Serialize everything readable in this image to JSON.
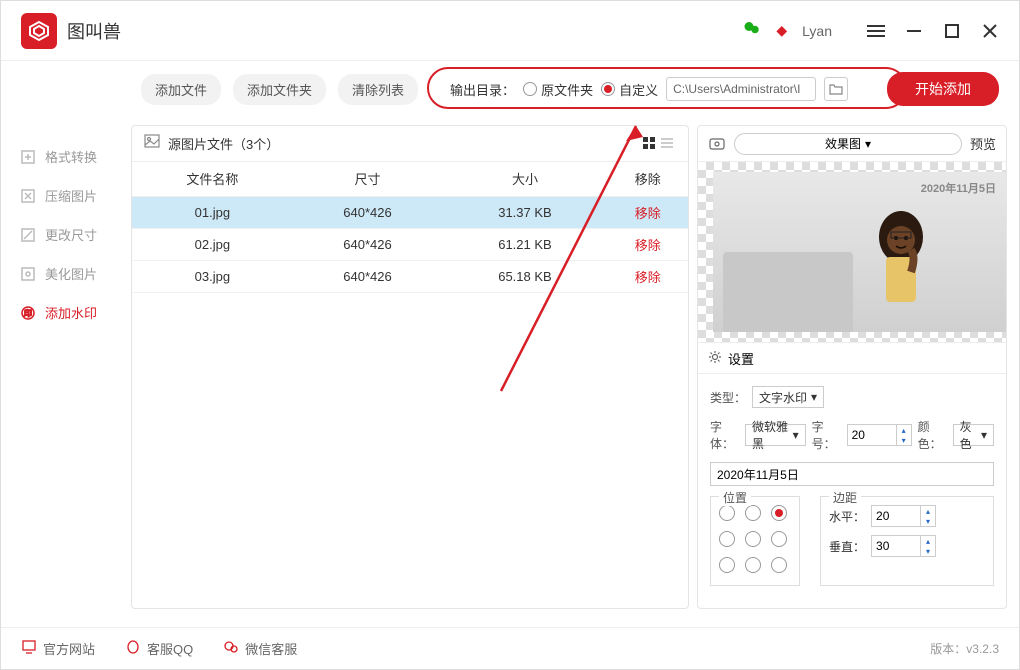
{
  "app": {
    "title": "图叫兽",
    "user": "Lyan"
  },
  "toolbar": {
    "add_file": "添加文件",
    "add_folder": "添加文件夹",
    "clear_list": "清除列表",
    "output_label": "输出目录：",
    "radio_original": "原文件夹",
    "radio_custom": "自定义",
    "path": "C:\\Users\\Administrator\\I",
    "start": "开始添加"
  },
  "sidebar": {
    "items": [
      {
        "label": "格式转换",
        "icon": "convert-icon"
      },
      {
        "label": "压缩图片",
        "icon": "compress-icon"
      },
      {
        "label": "更改尺寸",
        "icon": "resize-icon"
      },
      {
        "label": "美化图片",
        "icon": "beautify-icon"
      },
      {
        "label": "添加水印",
        "icon": "watermark-icon"
      }
    ]
  },
  "filelist": {
    "title": "源图片文件（3个）",
    "columns": {
      "name": "文件名称",
      "size": "尺寸",
      "filesize": "大小",
      "remove": "移除"
    },
    "rows": [
      {
        "name": "01.jpg",
        "size": "640*426",
        "filesize": "31.37 KB",
        "remove": "移除"
      },
      {
        "name": "02.jpg",
        "size": "640*426",
        "filesize": "61.21 KB",
        "remove": "移除"
      },
      {
        "name": "03.jpg",
        "size": "640*426",
        "filesize": "65.18 KB",
        "remove": "移除"
      }
    ]
  },
  "preview": {
    "effect_label": "效果图",
    "preview_label": "预览",
    "watermark": "2020年11月5日"
  },
  "settings": {
    "header": "设置",
    "type_label": "类型：",
    "type_value": "文字水印",
    "font_label": "字体：",
    "font_value": "微软雅黑",
    "fontsize_label": "字号：",
    "fontsize_value": "20",
    "color_label": "颜色：",
    "color_value": "灰色",
    "text_value": "2020年11月5日",
    "position_label": "位置",
    "margin_label": "边距",
    "horizontal_label": "水平：",
    "horizontal_value": "20",
    "vertical_label": "垂直：",
    "vertical_value": "30"
  },
  "footer": {
    "website": "官方网站",
    "qq": "客服QQ",
    "wechat": "微信客服",
    "version": "版本：v3.2.3"
  }
}
